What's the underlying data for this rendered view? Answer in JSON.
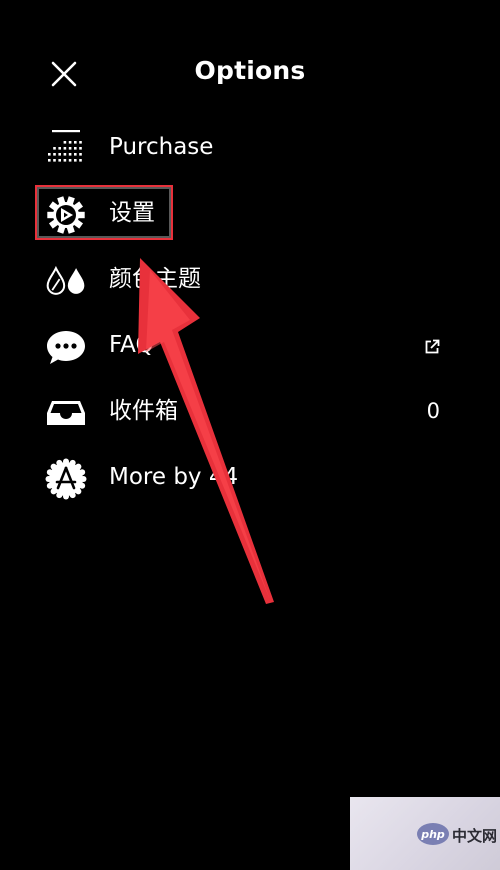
{
  "header": {
    "title": "Options",
    "close_icon": "close-icon"
  },
  "menu": {
    "items": [
      {
        "label": "Purchase",
        "icon": "purchase-grid-icon",
        "trailing": ""
      },
      {
        "label": "设置",
        "icon": "gear-icon",
        "trailing": ""
      },
      {
        "label": "颜色主题",
        "icon": "drops-icon",
        "trailing": ""
      },
      {
        "label": "FAQ",
        "icon": "chat-bubble-icon",
        "trailing": "external-link-icon"
      },
      {
        "label": "收件箱",
        "icon": "inbox-tray-icon",
        "trailing": "0"
      },
      {
        "label": "More by 44",
        "icon": "app-store-icon",
        "trailing": ""
      }
    ]
  },
  "annotation": {
    "color": "#e8313b"
  },
  "watermark": {
    "logo_text": "php",
    "text": "中文网"
  }
}
